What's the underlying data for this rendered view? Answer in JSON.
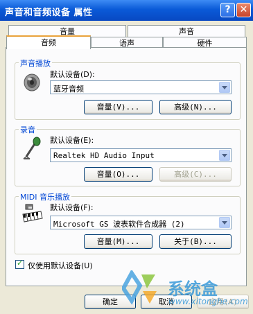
{
  "window": {
    "title": "声音和音频设备 属性",
    "help_glyph": "?",
    "close_glyph": "✕"
  },
  "tabs": {
    "row1": [
      "音量",
      "声音"
    ],
    "row2": [
      "音频",
      "语声",
      "硬件"
    ],
    "active": "音频"
  },
  "playback": {
    "group_title": "声音播放",
    "default_label": "默认设备(D):",
    "device": "蓝牙音频",
    "volume_button": "音量(V)...",
    "advanced_button": "高级(N)..."
  },
  "recording": {
    "group_title": "录音",
    "default_label": "默认设备(E):",
    "device": "Realtek HD Audio Input",
    "volume_button": "音量(O)...",
    "advanced_button": "高级(C)..."
  },
  "midi": {
    "group_title": "MIDI 音乐播放",
    "default_label": "默认设备(F):",
    "device": "Microsoft GS 波表软件合成器 (2)",
    "volume_button": "音量(M)...",
    "about_button": "关于(B)..."
  },
  "default_only_checkbox": {
    "label": "仅使用默认设备(U)",
    "checked": true
  },
  "footer": {
    "ok": "确定",
    "cancel": "取消",
    "apply": "应用(A)"
  },
  "watermark": {
    "brand": "系统盒",
    "url": "www.xitonghe.com"
  },
  "colors": {
    "titlebar": "#0a5ad8",
    "group_title": "#0046d5",
    "tab_highlight": "#e9a23b"
  }
}
